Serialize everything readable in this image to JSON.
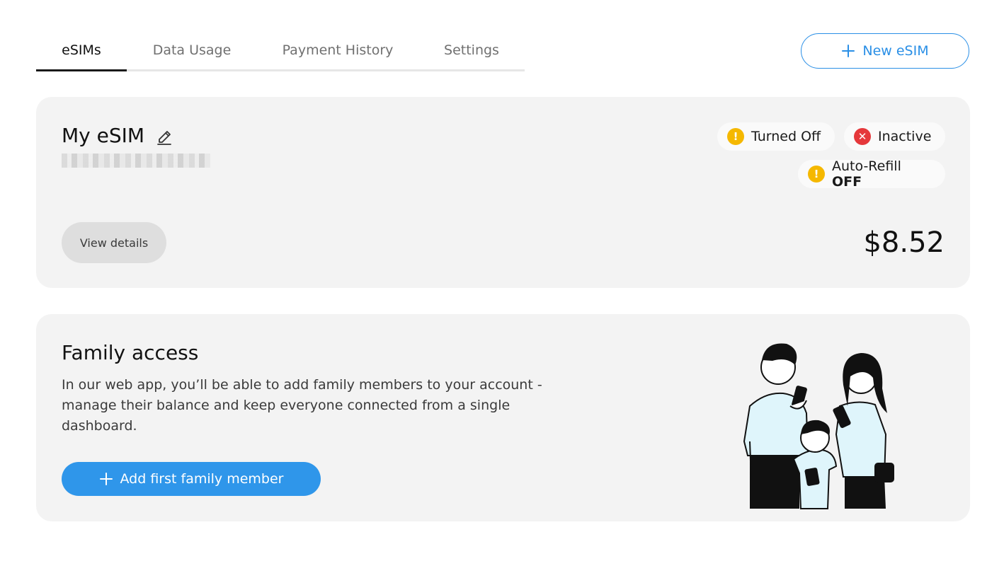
{
  "tabs": [
    {
      "label": "eSIMs",
      "active": true
    },
    {
      "label": "Data Usage",
      "active": false
    },
    {
      "label": "Payment History",
      "active": false
    },
    {
      "label": "Settings",
      "active": false
    }
  ],
  "header": {
    "new_esim_label": "New eSIM"
  },
  "esim_card": {
    "title": "My eSIM",
    "badges": {
      "turned_off": "Turned Off",
      "inactive": "Inactive",
      "auto_refill_label": "Auto-Refill",
      "auto_refill_value": "OFF"
    },
    "view_details_label": "View details",
    "balance": "$8.52"
  },
  "family_card": {
    "title": "Family access",
    "description": "In our web app, you’ll be able to add family members to your account - manage their balance and keep everyone connected from a single dashboard.",
    "add_button_label": "Add first family member"
  },
  "colors": {
    "accent": "#2f96ea",
    "warning": "#f5b800",
    "error": "#e5383b",
    "card_bg": "#f3f3f3"
  },
  "icons": [
    "plus-icon",
    "pencil-icon",
    "warning-icon",
    "error-icon"
  ]
}
